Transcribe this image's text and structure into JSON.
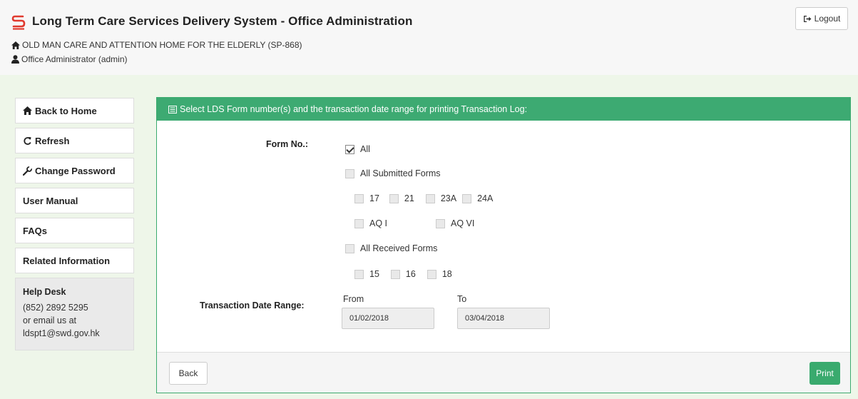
{
  "header": {
    "title": "Long Term Care Services Delivery System - Office Administration",
    "organization": "OLD MAN CARE AND ATTENTION HOME FOR THE ELDERLY (SP-868)",
    "user": "Office Administrator (admin)",
    "logout_label": "Logout"
  },
  "sidebar": {
    "items": [
      {
        "label": "Back to Home",
        "icon": "home-icon"
      },
      {
        "label": "Refresh",
        "icon": "refresh-icon"
      },
      {
        "label": "Change Password",
        "icon": "wrench-icon"
      },
      {
        "label": "User Manual"
      },
      {
        "label": "FAQs"
      },
      {
        "label": "Related Information"
      }
    ],
    "helpdesk": {
      "title": "Help Desk",
      "phone": "(852) 2892 5295",
      "line2": "or email us at",
      "email": "ldspt1@swd.gov.hk"
    }
  },
  "panel": {
    "heading": "Select LDS Form number(s) and the transaction date range for printing Transaction Log:",
    "form_no_label": "Form No.:",
    "all_label": "All",
    "all_submitted_label": "All Submitted Forms",
    "submitted_forms": [
      "17",
      "21",
      "23A",
      "24A"
    ],
    "aq_forms": [
      "AQ I",
      "AQ VI"
    ],
    "all_received_label": "All Received Forms",
    "received_forms": [
      "15",
      "16",
      "18"
    ],
    "date_range_label": "Transaction Date Range:",
    "from_label": "From",
    "to_label": "To",
    "from_value": "01/02/2018",
    "to_value": "03/04/2018",
    "back_label": "Back",
    "print_label": "Print"
  },
  "colors": {
    "accent_green": "#3daa72",
    "logo_red": "#e03a2f",
    "content_bg": "#eef6e9"
  }
}
